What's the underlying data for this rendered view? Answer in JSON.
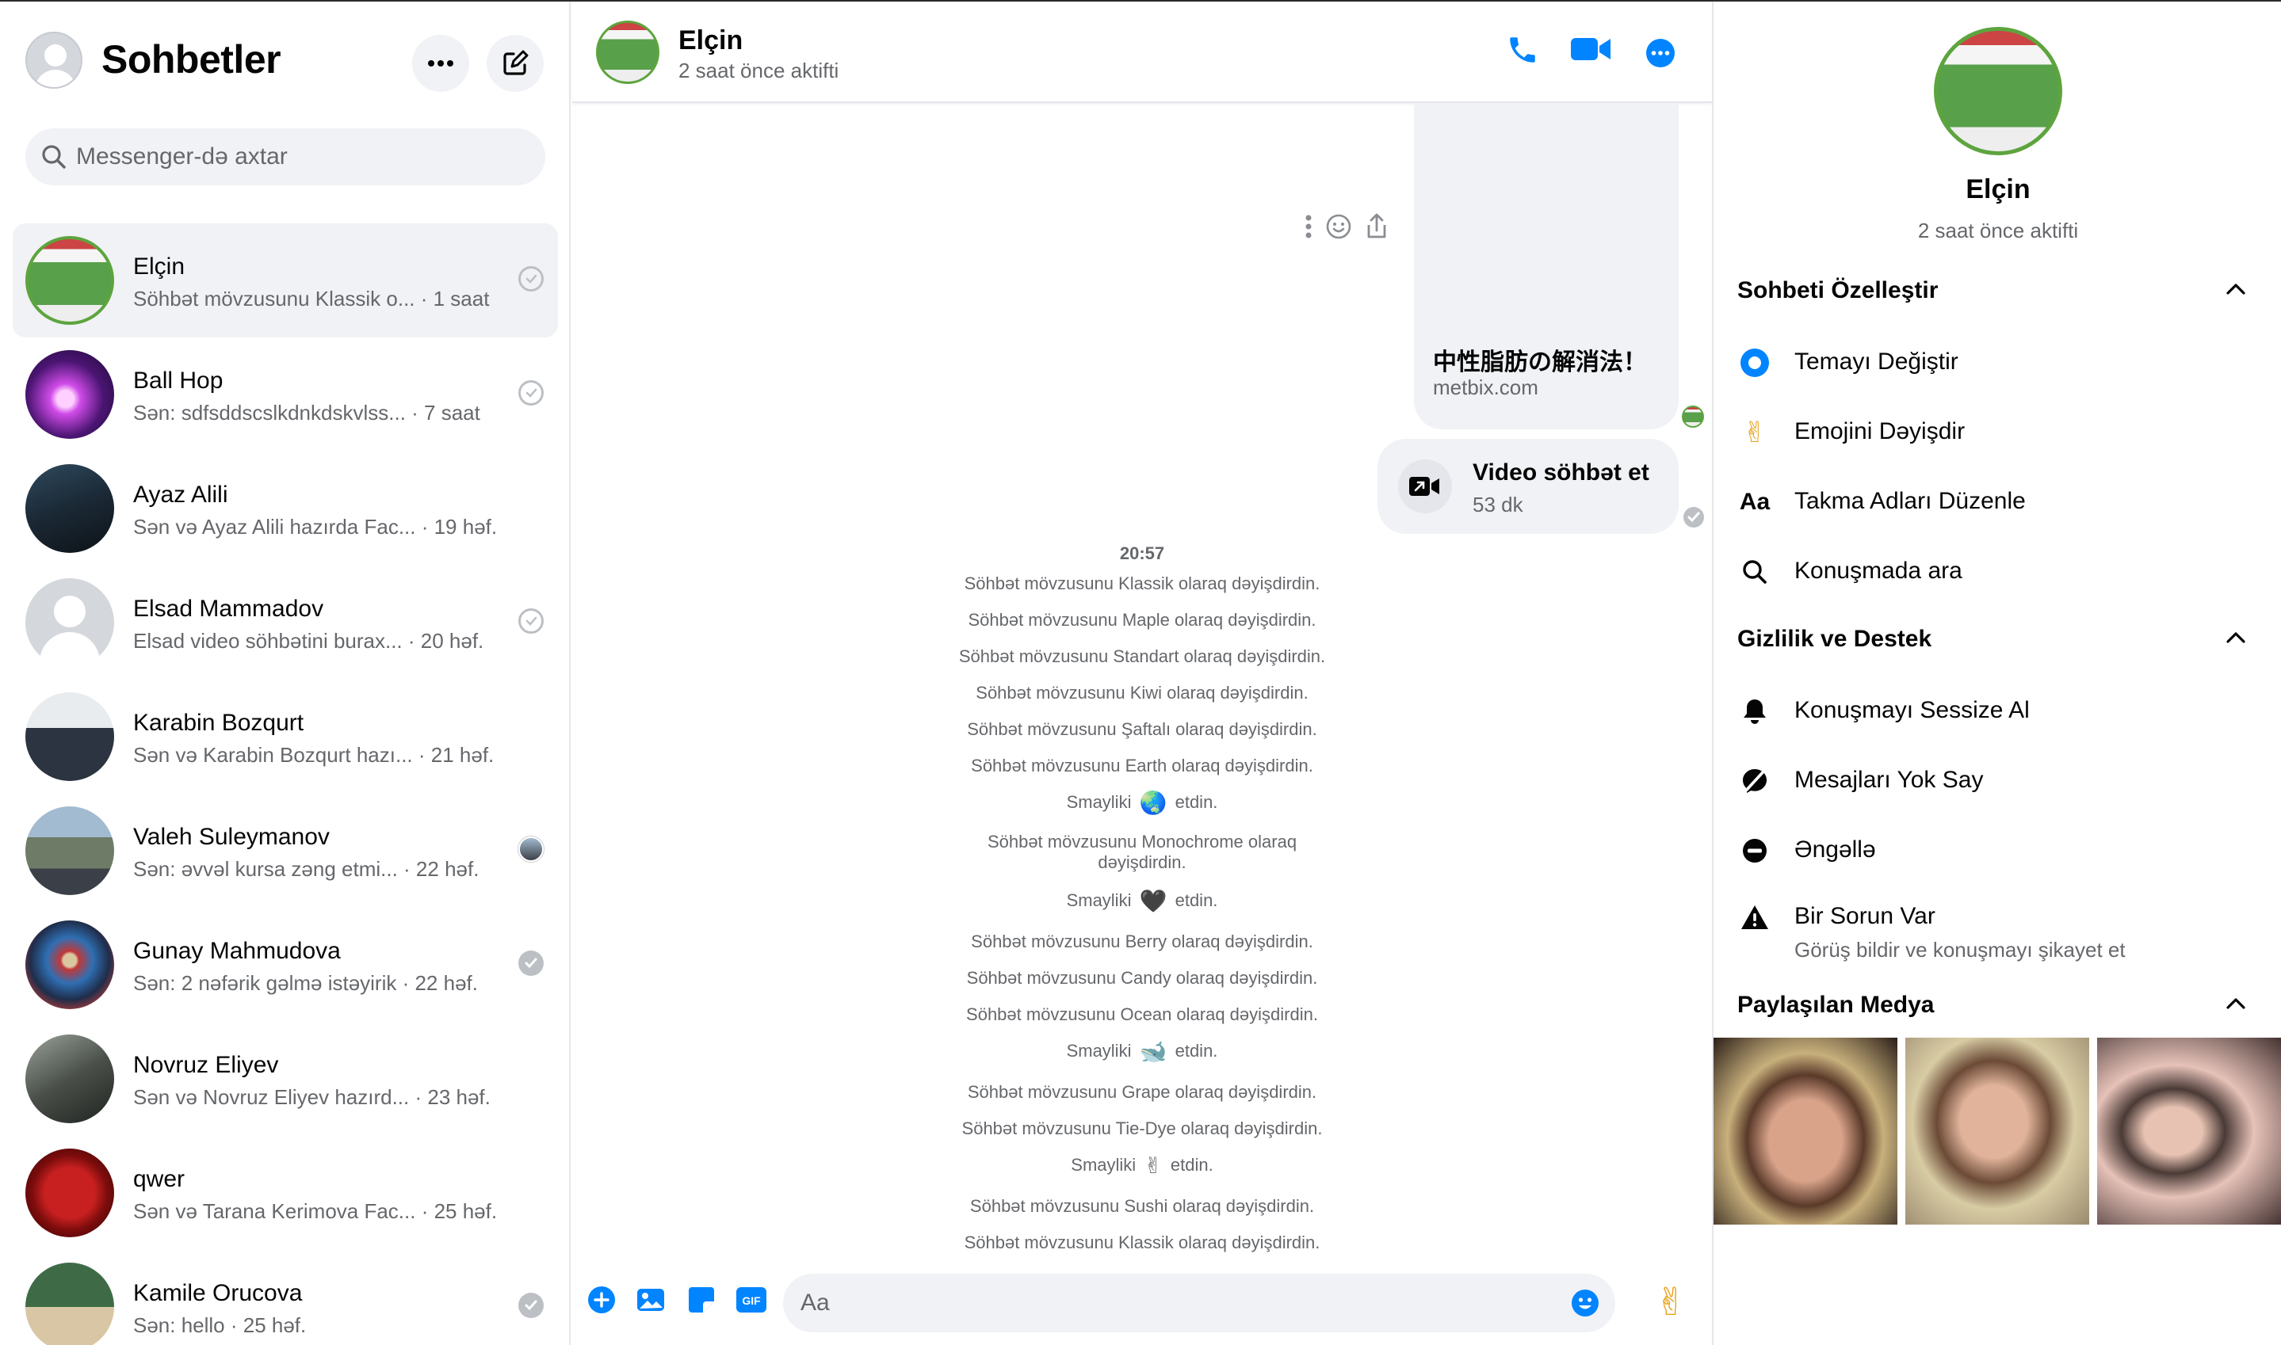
{
  "sidebar": {
    "title": "Sohbetler",
    "search_placeholder": "Messenger-də axtar",
    "conversations": [
      {
        "name": "Elçin",
        "preview": "Söhbət mövzusunu Klassik o... · 1 saat",
        "status": "sent",
        "avatar": "elcin",
        "active": true
      },
      {
        "name": "Ball Hop",
        "preview": "Sən: sdfsddscslkdnkdskvlss... · 7 saat",
        "status": "sent",
        "avatar": "ball"
      },
      {
        "name": "Ayaz Alili",
        "preview": "Sən və Ayaz Alili hazırda Fac... · 19 həf.",
        "status": "none",
        "avatar": "ayaz"
      },
      {
        "name": "Elsad Mammadov",
        "preview": "Elsad video söhbətini burax... · 20 həf.",
        "status": "sent",
        "avatar": "elsad"
      },
      {
        "name": "Karabin Bozqurt",
        "preview": "Sən və Karabin Bozqurt hazı... · 21 həf.",
        "status": "none",
        "avatar": "karabin"
      },
      {
        "name": "Valeh Suleymanov",
        "preview": "Sən: əvvəl kursa zəng etmi... · 22 həf.",
        "status": "read",
        "avatar": "valeh"
      },
      {
        "name": "Gunay Mahmudova",
        "preview": "Sən: 2 nəfərik gəlmə istəyirik · 22 həf.",
        "status": "delivered",
        "avatar": "gunay"
      },
      {
        "name": "Novruz Eliyev",
        "preview": "Sən və Novruz Eliyev hazırd... · 23 həf.",
        "status": "none",
        "avatar": "novruz"
      },
      {
        "name": "qwer",
        "preview": "Sən və Tarana Kerimova Fac... · 25 həf.",
        "status": "none",
        "avatar": "qwer"
      },
      {
        "name": "Kamile Orucova",
        "preview": "Sən: hello · 25 həf.",
        "status": "delivered",
        "avatar": "kamile"
      }
    ]
  },
  "chat": {
    "name": "Elçin",
    "status": "2 saat önce aktifti",
    "link_card": {
      "title": "中性脂肪の解消法！",
      "domain": "metbix.com"
    },
    "video_card": {
      "title": "Video söhbət et",
      "subtitle": "53 dk"
    },
    "timestamp": "20:57",
    "events": [
      {
        "text": "Söhbət mövzusunu Klassik olaraq dəyişdirdin."
      },
      {
        "text": "Söhbət mövzusunu Maple olaraq dəyişdirdin."
      },
      {
        "text": "Söhbət mövzusunu Standart olaraq dəyişdirdin."
      },
      {
        "text": "Söhbət mövzusunu Kiwi olaraq dəyişdirdin."
      },
      {
        "text": "Söhbət mövzusunu Şaftalı olaraq dəyişdirdin."
      },
      {
        "text": "Söhbət mövzusunu Earth olaraq dəyişdirdin."
      },
      {
        "pre": "Smayliki",
        "emoji": "🌏",
        "post": "etdin."
      },
      {
        "text": "Söhbət mövzusunu Monochrome olaraq dəyişdirdin.",
        "two_line": true
      },
      {
        "pre": "Smayliki",
        "emoji": "🖤",
        "post": "etdin."
      },
      {
        "text": "Söhbət mövzusunu Berry olaraq dəyişdirdin."
      },
      {
        "text": "Söhbət mövzusunu Candy olaraq dəyişdirdin."
      },
      {
        "text": "Söhbət mövzusunu Ocean olaraq dəyişdirdin."
      },
      {
        "pre": "Smayliki",
        "emoji": "🐋",
        "post": "etdin."
      },
      {
        "text": "Söhbət mövzusunu Grape olaraq dəyişdirdin."
      },
      {
        "text": "Söhbət mövzusunu Tie-Dye olaraq dəyişdirdin."
      },
      {
        "pre": "Smayliki",
        "emoji": "✌",
        "post": "etdin."
      },
      {
        "text": "Söhbət mövzusunu Sushi olaraq dəyişdirdin."
      },
      {
        "text": "Söhbət mövzusunu Klassik olaraq dəyişdirdin."
      }
    ],
    "composer_placeholder": "Aa",
    "quick_emoji": "✌"
  },
  "info": {
    "name": "Elçin",
    "status": "2 saat önce aktifti",
    "customize_header": "Sohbeti Özelleştir",
    "customize_options": [
      {
        "icon": "theme-icon",
        "label": "Temayı Değiştir"
      },
      {
        "icon": "emoji-icon",
        "label": "Emojini Dəyişdir",
        "glyph": "✌"
      },
      {
        "icon": "nickname-icon",
        "label": "Takma Adları Düzenle",
        "glyph": "Aa"
      },
      {
        "icon": "search-icon",
        "label": "Konuşmada ara"
      }
    ],
    "privacy_header": "Gizlilik ve Destek",
    "privacy_options": [
      {
        "icon": "bell-icon",
        "label": "Konuşmayı Sessize Al"
      },
      {
        "icon": "ignore-icon",
        "label": "Mesajları Yok Say"
      },
      {
        "icon": "block-icon",
        "label": "Əngəllə"
      },
      {
        "icon": "warning-icon",
        "label": "Bir Sorun Var",
        "sub": "Görüş bildir ve konuşmayı şikayet et"
      }
    ],
    "media_header": "Paylaşılan Medya"
  },
  "colors": {
    "accent": "#0084ff",
    "secondary_text": "#65676b",
    "bubble_bg": "#f0f2f5"
  }
}
